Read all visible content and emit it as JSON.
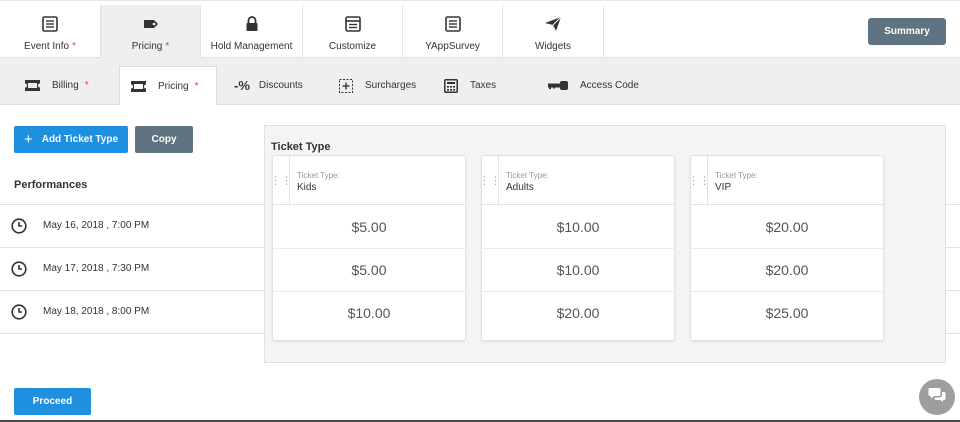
{
  "top_tabs": [
    {
      "label": "Event Info",
      "required": "*",
      "icon": "list-icon"
    },
    {
      "label": "Pricing",
      "required": "*",
      "icon": "tag-icon"
    },
    {
      "label": "Hold Management",
      "icon": "lock-icon"
    },
    {
      "label": "Customize",
      "icon": "window-icon"
    },
    {
      "label": "YAppSurvey",
      "icon": "list-icon"
    },
    {
      "label": "Widgets",
      "icon": "send-icon"
    }
  ],
  "summary_label": "Summary",
  "sub_tabs": [
    {
      "label": "Billing",
      "required": "*",
      "icon": "ticket-icon"
    },
    {
      "label": "Pricing",
      "required": "*",
      "icon": "ticket-icon"
    },
    {
      "label": "Discounts",
      "icon_text": "-%"
    },
    {
      "label": "Surcharges",
      "icon": "plus-box-icon"
    },
    {
      "label": "Taxes",
      "icon": "calculator-icon"
    },
    {
      "label": "Access Code",
      "icon": "key-icon"
    }
  ],
  "actions": {
    "add_ticket_type": "Add Ticket Type",
    "add_plus": "+",
    "copy": "Copy",
    "proceed": "Proceed"
  },
  "performances": {
    "title": "Performances",
    "rows": [
      "May 16, 2018 , 7:00 PM",
      "May 17, 2018 , 7:30 PM",
      "May 18, 2018 , 8:00 PM"
    ]
  },
  "matrix": {
    "title": "Ticket Type",
    "column_label": "Ticket Type:",
    "columns": [
      {
        "name": "Kids",
        "prices": [
          "$5.00",
          "$5.00",
          "$10.00"
        ]
      },
      {
        "name": "Adults",
        "prices": [
          "$10.00",
          "$10.00",
          "$20.00"
        ]
      },
      {
        "name": "VIP",
        "prices": [
          "$20.00",
          "$20.00",
          "$25.00"
        ]
      }
    ]
  },
  "colors": {
    "primary": "#1f8fe0",
    "secondary": "#5f7380",
    "required": "#e53935"
  }
}
